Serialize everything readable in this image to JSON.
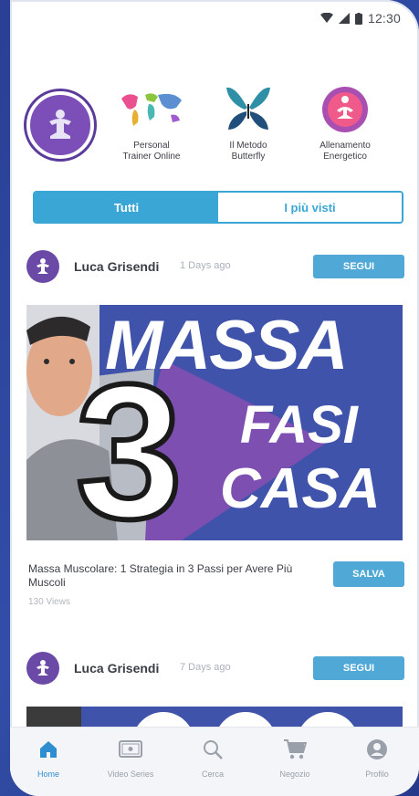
{
  "status_bar": {
    "time": "12:30"
  },
  "categories": [
    {
      "label": "Personal\nTrainer Online",
      "icon": "world-map-icon"
    },
    {
      "label": "Il Metodo\nButterfly",
      "icon": "butterfly-icon"
    },
    {
      "label": "Allenamento\nEnergetico",
      "icon": "meditation-icon"
    }
  ],
  "segmented": {
    "all": "Tutti",
    "most_viewed": "I più visti",
    "selected": "Tutti"
  },
  "posts": [
    {
      "author": "Luca Grisendi",
      "ago": "1 Days ago",
      "follow": "SEGUI",
      "thumbnail_text": {
        "line1": "MASSA",
        "big": "3",
        "line2": "FASI",
        "line3": "CASA"
      },
      "title": "Massa Muscolare: 1 Strategia in 3 Passi per Avere Più Muscoli",
      "views": "130 Views",
      "save": "SALVA"
    },
    {
      "author": "Luca Grisendi",
      "ago": "7 Days ago",
      "follow": "SEGUI"
    }
  ],
  "tabbar": [
    {
      "label": "Home",
      "icon": "home-icon",
      "active": true
    },
    {
      "label": "Video Series",
      "icon": "video-series-icon",
      "active": false
    },
    {
      "label": "Cerca",
      "icon": "search-icon",
      "active": false
    },
    {
      "label": "Negozio",
      "icon": "cart-icon",
      "active": false
    },
    {
      "label": "Profilo",
      "icon": "profile-icon",
      "active": false
    }
  ],
  "colors": {
    "accent": "#3aa6d6",
    "brand_purple": "#6a4aa6",
    "background": "#324ea8"
  }
}
